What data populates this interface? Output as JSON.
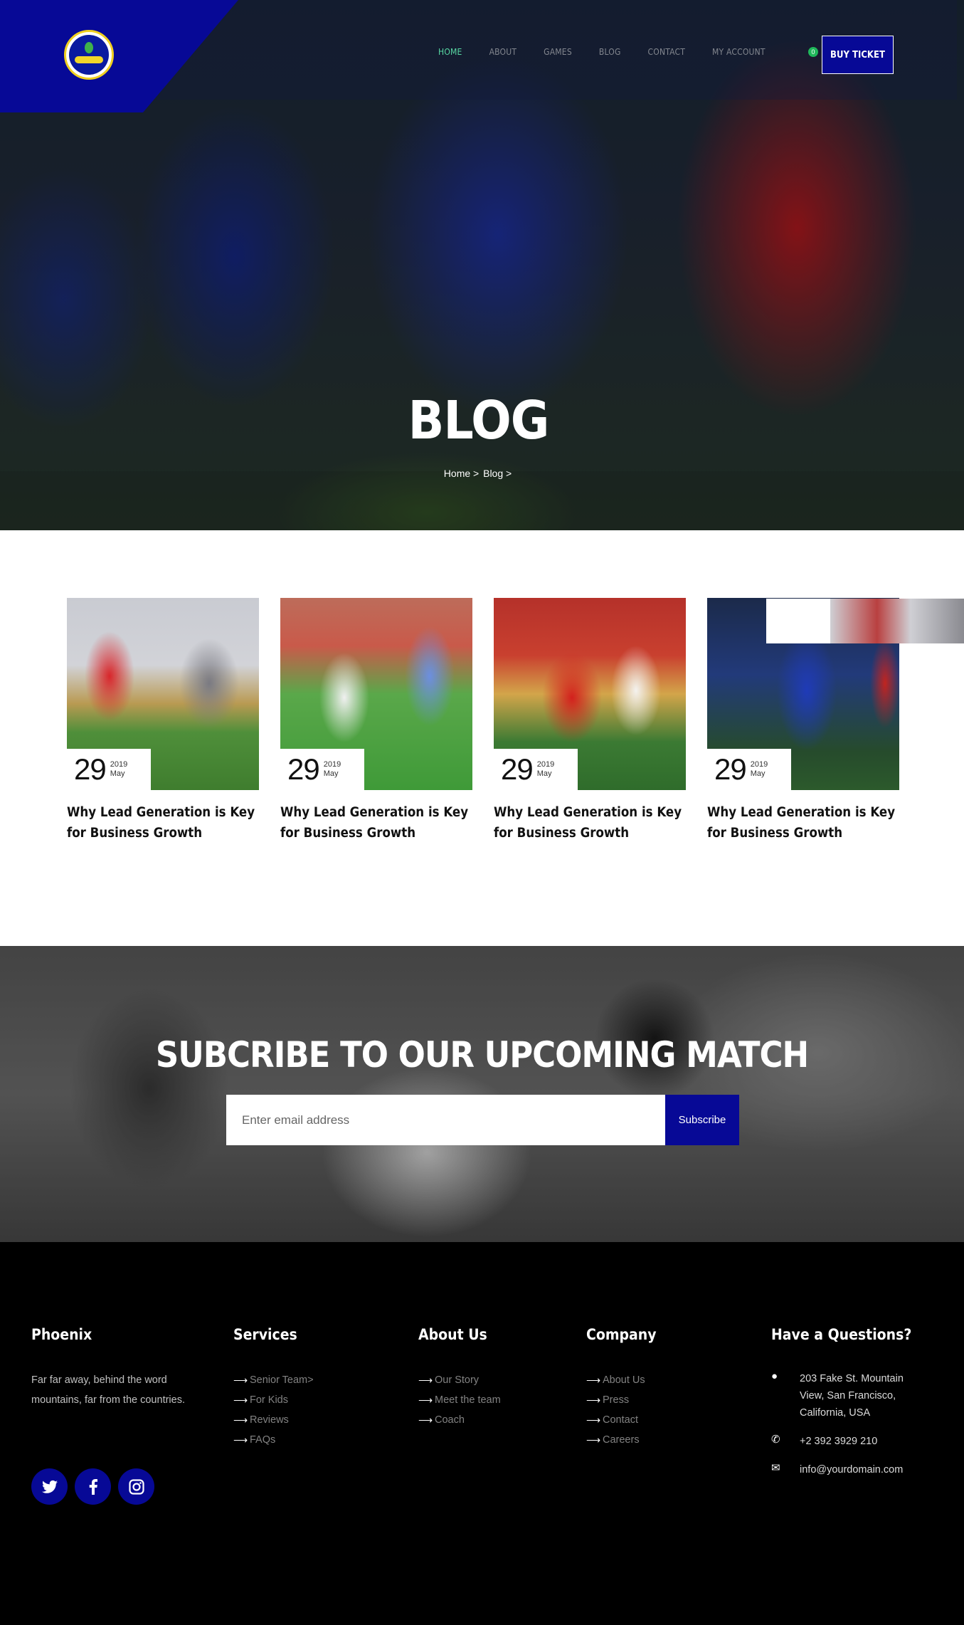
{
  "colors": {
    "brand_blue": "#070996",
    "active_nav": "#58d9a4",
    "footer_bg": "#000000"
  },
  "nav": {
    "items": [
      "HOME",
      "ABOUT",
      "GAMES",
      "BLOG",
      "CONTACT",
      "MY ACCOUNT"
    ],
    "cart_count": "0",
    "buy_ticket": "BUY TICKET"
  },
  "hero": {
    "title": "BLOG",
    "breadcrumb": {
      "home": "Home >",
      "current": "Blog >"
    }
  },
  "blog": {
    "posts": [
      {
        "day": "29",
        "year": "2019",
        "month": "May",
        "title": "Why Lead Generation is Key for Business Growth"
      },
      {
        "day": "29",
        "year": "2019",
        "month": "May",
        "title": "Why Lead Generation is Key for Business Growth"
      },
      {
        "day": "29",
        "year": "2019",
        "month": "May",
        "title": "Why Lead Generation is Key for Business Growth"
      },
      {
        "day": "29",
        "year": "2019",
        "month": "May",
        "title": "Why Lead Generation is Key for Business Growth"
      }
    ]
  },
  "subscribe": {
    "title": "SUBCRIBE TO OUR UPCOMING MATCH",
    "placeholder": "Enter email address",
    "button": "Subscribe"
  },
  "footer": {
    "brand": {
      "heading": "Phoenix",
      "description": "Far far away, behind the word mountains, far from the countries."
    },
    "services": {
      "heading": "Services",
      "items": [
        "Senior Team>",
        "For Kids",
        "Reviews",
        "FAQs"
      ]
    },
    "about": {
      "heading": "About Us",
      "items": [
        "Our Story",
        "Meet the team",
        "Coach"
      ]
    },
    "company": {
      "heading": "Company",
      "items": [
        "About Us",
        "Press",
        "Contact",
        "Careers"
      ]
    },
    "questions": {
      "heading": "Have a Questions?",
      "address": "203 Fake St. Mountain View, San Francisco, California, USA",
      "phone": "+2 392 3929 210",
      "email": "info@yourdomain.com"
    },
    "social_icons": [
      "twitter-icon",
      "facebook-icon",
      "instagram-icon"
    ]
  }
}
